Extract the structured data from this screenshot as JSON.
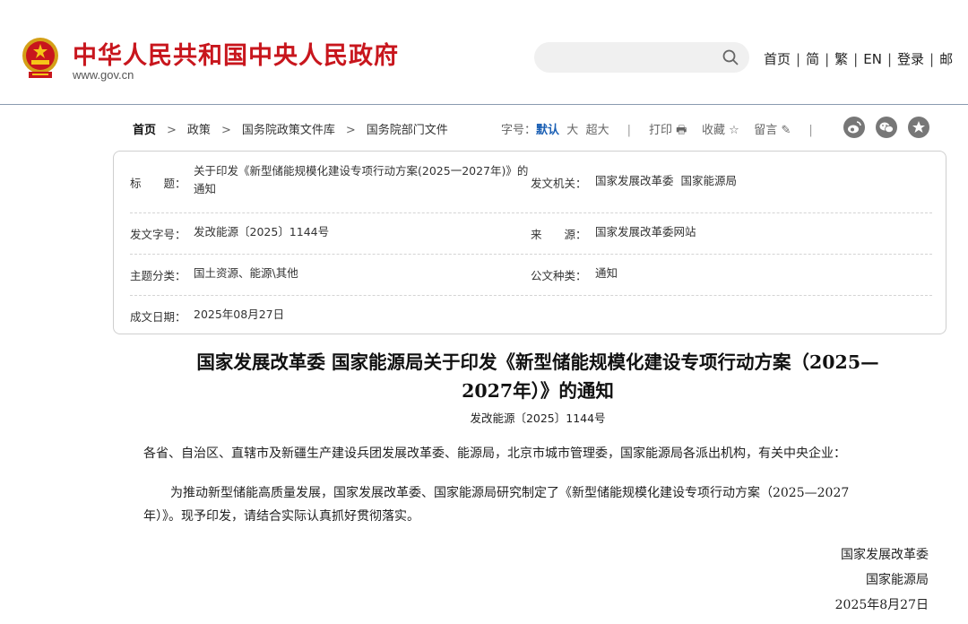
{
  "header": {
    "site_name": "中华人民共和国中央人民政府",
    "site_url": "www.gov.cn",
    "nav": [
      "首页",
      "简",
      "繁",
      "EN",
      "登录",
      "邮"
    ]
  },
  "breadcrumb": [
    "首页",
    "政策",
    "国务院政策文件库",
    "国务院部门文件"
  ],
  "tools": {
    "font_label": "字号：",
    "font_default": "默认",
    "font_large": "大",
    "font_xlarge": "超大",
    "print": "打印",
    "favorite": "收藏",
    "comment": "留言"
  },
  "meta": {
    "title_label": "标　　题：",
    "title_value": "关于印发《新型储能规模化建设专项行动方案(2025一2027年)》的通知",
    "issuer_label": "发文机关：",
    "issuer_value": "国家发展改革委  国家能源局",
    "doc_no_label": "发文字号：",
    "doc_no_value": "发改能源〔2025〕1144号",
    "source_label": "来　　源：",
    "source_value": "国家发展改革委网站",
    "topic_label": "主题分类：",
    "topic_value": "国土资源、能源\\其他",
    "type_label": "公文种类：",
    "type_value": "通知",
    "date_label": "成文日期：",
    "date_value": "2025年08月27日"
  },
  "article": {
    "title_line1": "国家发展改革委 国家能源局关于印发《新型储能规模化建设专项行动方案（2025—",
    "title_line2": "2027年）》的通知",
    "doc_number": "发改能源〔2025〕1144号",
    "salutation": "各省、自治区、直辖市及新疆生产建设兵团发展改革委、能源局，北京市城市管理委，国家能源局各派出机构，有关中央企业：",
    "body_line1": "为推动新型储能高质量发展，国家发展改革委、国家能源局研究制定了《新型储能规模化建设专项行动方案（2025—2027",
    "body_line2": "年）》。现予印发，请结合实际认真抓好贯彻落实。",
    "sign1": "国家发展改革委",
    "sign2": "国家能源局",
    "sign_date": "2025年8月27日"
  },
  "colors": {
    "brand_red": "#c8161d",
    "accent_blue": "#1a5fb4"
  }
}
